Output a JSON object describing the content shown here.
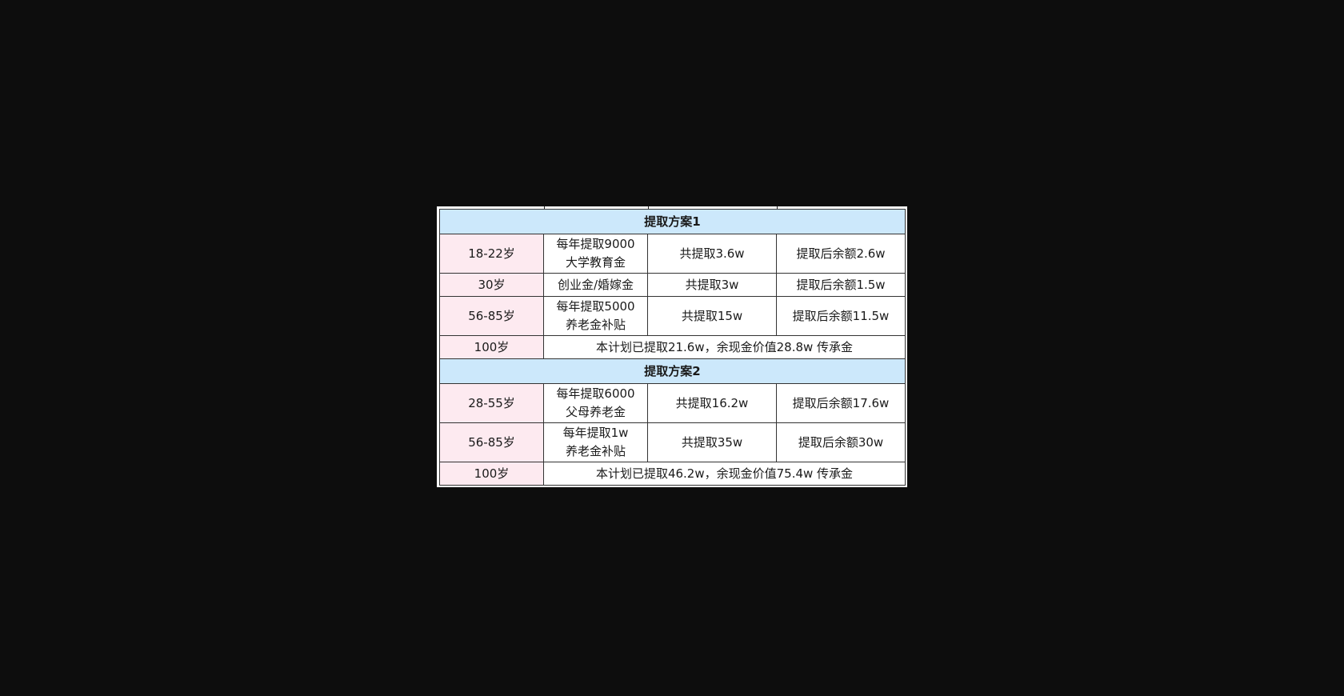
{
  "plans": [
    {
      "title": "提取方案1",
      "rows": [
        {
          "age": "18-22岁",
          "desc_line1": "每年提取9000",
          "desc_line2": "大学教育金",
          "total": "共提取3.6w",
          "balance": "提取后余额2.6w"
        },
        {
          "age": "30岁",
          "desc_line1": "创业金/婚嫁金",
          "desc_line2": "",
          "total": "共提取3w",
          "balance": "提取后余额1.5w"
        },
        {
          "age": "56-85岁",
          "desc_line1": "每年提取5000",
          "desc_line2": "养老金补贴",
          "total": "共提取15w",
          "balance": "提取后余额11.5w"
        }
      ],
      "summary": {
        "age": "100岁",
        "text": "本计划已提取21.6w，余现金价值28.8w 传承金"
      }
    },
    {
      "title": "提取方案2",
      "rows": [
        {
          "age": "28-55岁",
          "desc_line1": "每年提取6000",
          "desc_line2": "父母养老金",
          "total": "共提取16.2w",
          "balance": "提取后余额17.6w"
        },
        {
          "age": "56-85岁",
          "desc_line1": "每年提取1w",
          "desc_line2": "养老金补贴",
          "total": "共提取35w",
          "balance": "提取后余额30w"
        }
      ],
      "summary": {
        "age": "100岁",
        "text": "本计划已提取46.2w，余现金价值75.4w 传承金"
      }
    }
  ],
  "colors": {
    "background": "#0d0d0d",
    "section_header": "#cce8fb",
    "age_cell": "#fdeaf0",
    "border": "#333333"
  }
}
